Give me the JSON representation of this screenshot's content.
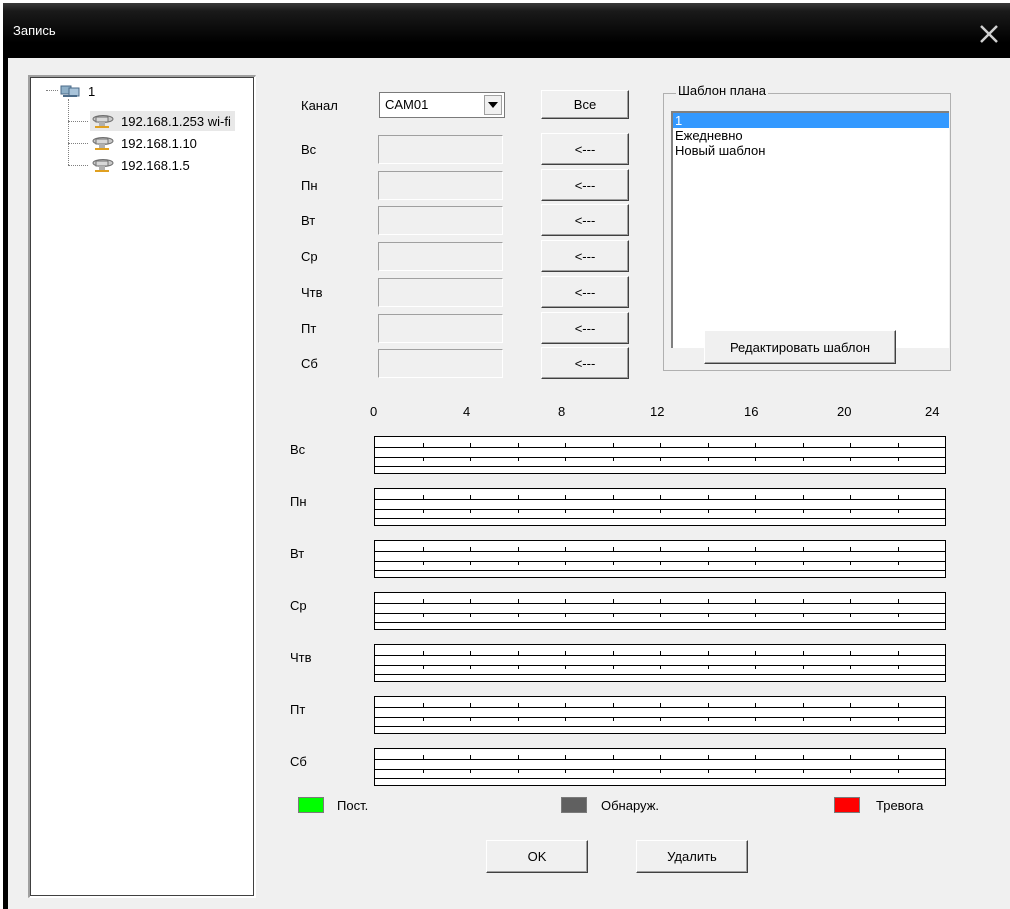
{
  "window": {
    "title": "Запись"
  },
  "tree": {
    "root": "1",
    "devices": [
      "192.168.1.253 wi-fi",
      "192.168.1.10",
      "192.168.1.5"
    ]
  },
  "channel": {
    "label": "Канал",
    "value": "CAM01",
    "all_button": "Все"
  },
  "days": [
    "Вс",
    "Пн",
    "Вт",
    "Ср",
    "Чтв",
    "Пт",
    "Сб"
  ],
  "copy_button": "<---",
  "template": {
    "group_title": "Шаблон плана",
    "items": [
      "1",
      "Ежедневно",
      "Новый шаблон"
    ],
    "selected_index": 0,
    "edit_button": "Редактировать шаблон"
  },
  "timeline": {
    "hours": [
      "0",
      "4",
      "8",
      "12",
      "16",
      "20",
      "24"
    ]
  },
  "legend": [
    {
      "label": "Пост.",
      "color": "#00ff00"
    },
    {
      "label": "Обнаруж.",
      "color": "#606060"
    },
    {
      "label": "Тревога",
      "color": "#ff0000"
    }
  ],
  "buttons": {
    "ok": "OK",
    "delete": "Удалить"
  }
}
